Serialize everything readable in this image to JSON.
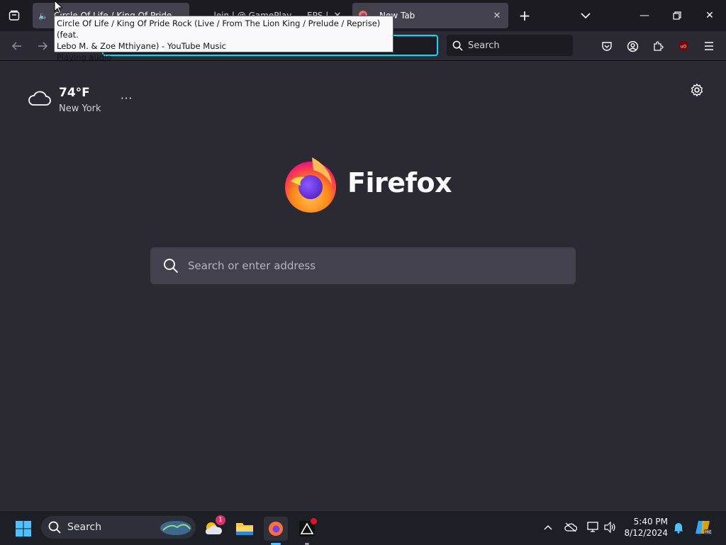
{
  "browser": {
    "tabs": [
      {
        "label": "Circle Of Life / King Of Pride R",
        "playing": true
      },
      {
        "label": "...lein | @ GamePlay... - EPS | ..."
      },
      {
        "label": "New Tab"
      }
    ],
    "tooltip": {
      "line1": "Circle Of Life / King Of Pride Rock (Live / From The Lion King / Prelude / Reprise) (feat.",
      "line2": "Lebo M. & Zoe Mthiyane) - YouTube Music",
      "line3": "Playing audio"
    },
    "search_placeholder": "Search"
  },
  "newtab": {
    "weather": {
      "temp": "74°F",
      "city": "New York",
      "menu": "···"
    },
    "wordmark": "Firefox",
    "search_placeholder": "Search or enter address"
  },
  "taskbar": {
    "search_label": "Search",
    "notification_count": "1",
    "time": "5:40 PM",
    "date": "8/12/2024"
  },
  "colors": {
    "accent": "#00ddff",
    "page_bg": "#2b2a33",
    "tabbar_bg": "#1c1b22",
    "taskbar_bg": "#1d1f27"
  }
}
